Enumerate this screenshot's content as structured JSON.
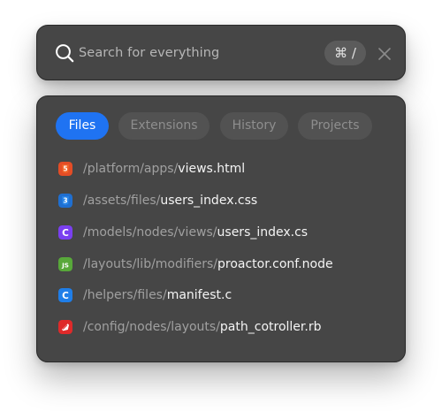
{
  "search": {
    "placeholder": "Search for everything",
    "value": "",
    "shortcut": "⌘ /"
  },
  "tabs": [
    {
      "label": "Files",
      "active": true
    },
    {
      "label": "Extensions",
      "active": false
    },
    {
      "label": "History",
      "active": false
    },
    {
      "label": "Projects",
      "active": false
    }
  ],
  "results": [
    {
      "dir": "/platform/apps/",
      "file": "views.html",
      "icon": "html5-icon"
    },
    {
      "dir": "/assets/files/",
      "file": "users_index.css",
      "icon": "css3-icon"
    },
    {
      "dir": "/models/nodes/views/",
      "file": "users_index.cs",
      "icon": "csharp-icon"
    },
    {
      "dir": "/layouts/lib/modifiers/",
      "file": "proactor.conf.node",
      "icon": "nodejs-icon"
    },
    {
      "dir": "/helpers/files/",
      "file": "manifest.c",
      "icon": "c-icon"
    },
    {
      "dir": "/config/nodes/layouts/",
      "file": "path_cotroller.rb",
      "icon": "ruby-icon"
    }
  ],
  "colors": {
    "panel": "#464646",
    "active_tab": "#1f73f2",
    "html": "#e44d26",
    "css": "#1f6fd1",
    "csharp": "#7a3ff0",
    "node": "#58a83a",
    "c": "#1f7ee8",
    "ruby": "#df2a2a"
  }
}
